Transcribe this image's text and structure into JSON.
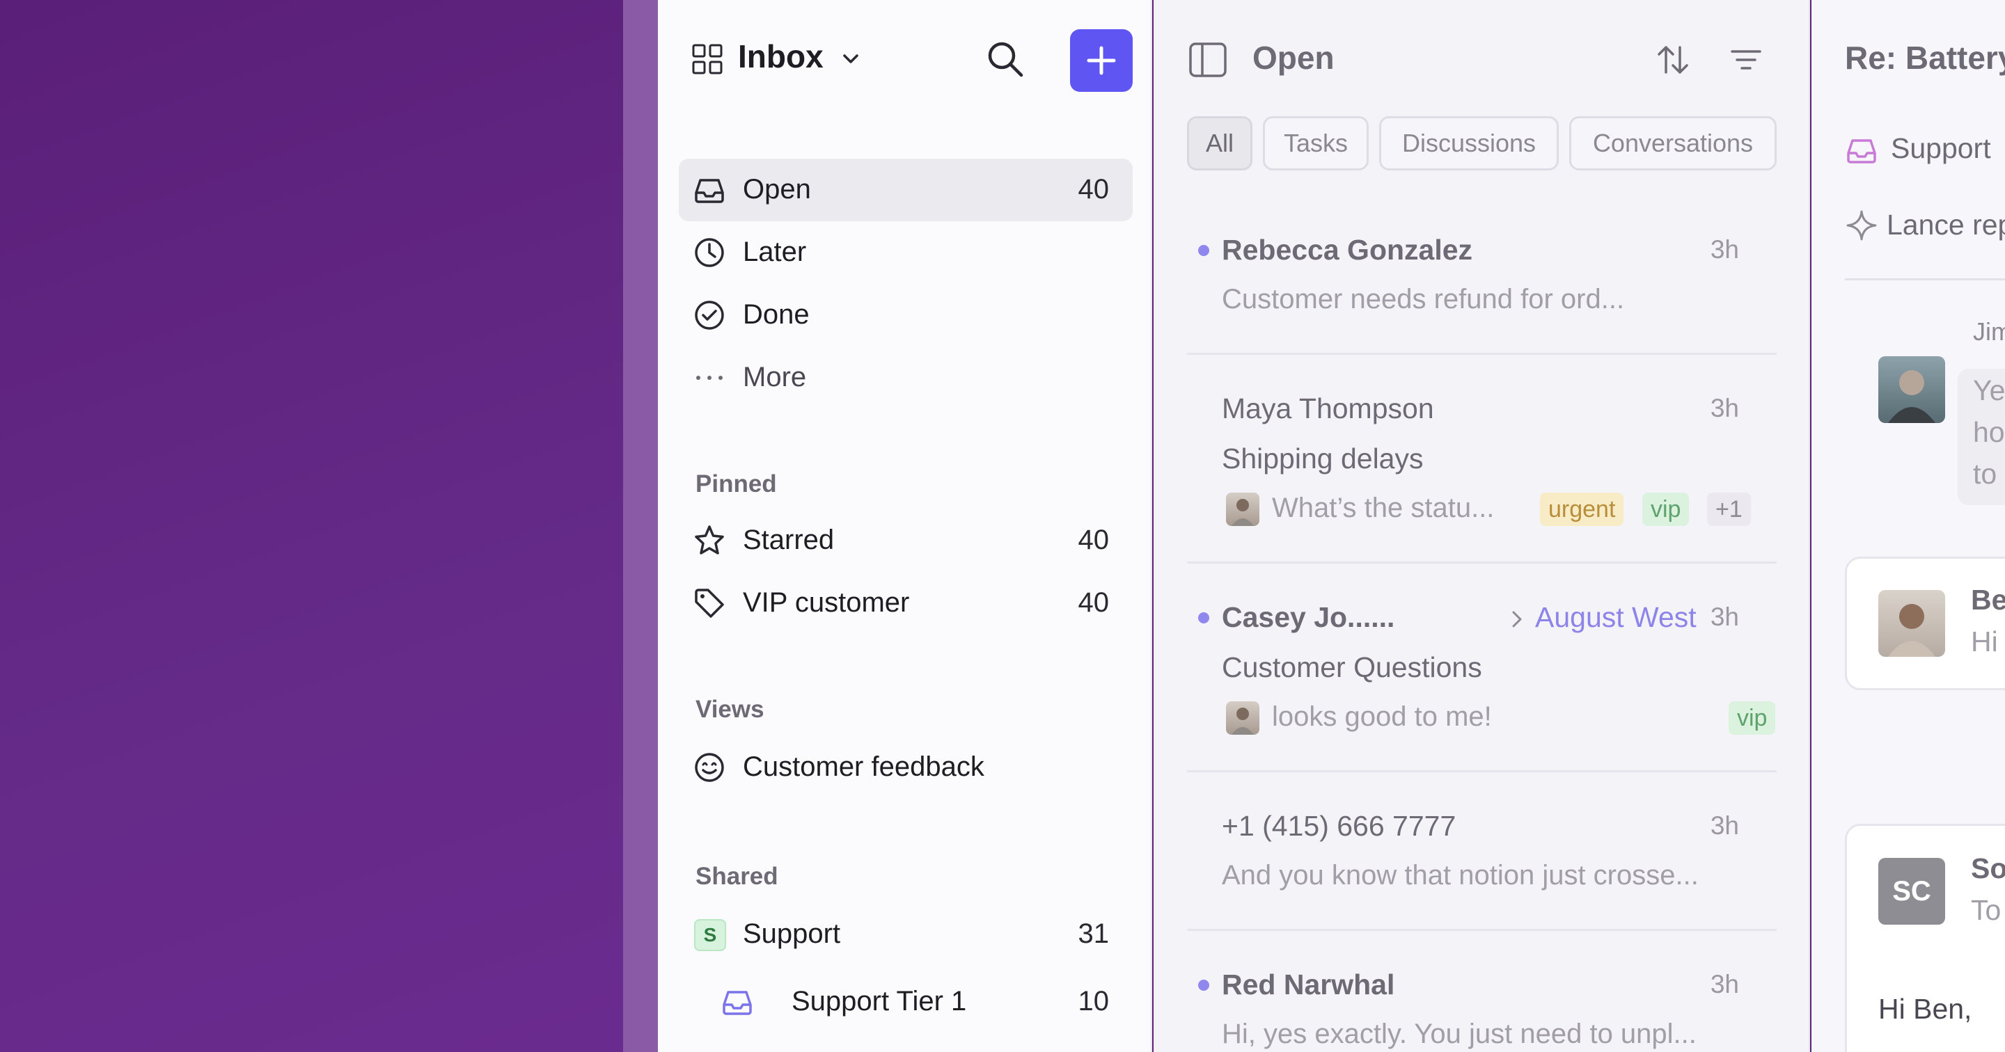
{
  "sidebar": {
    "title": "Inbox",
    "nav": [
      {
        "label": "Open",
        "count": "40"
      },
      {
        "label": "Later"
      },
      {
        "label": "Done"
      },
      {
        "label": "More"
      }
    ],
    "pinned_title": "Pinned",
    "pinned": [
      {
        "label": "Starred",
        "count": "40"
      },
      {
        "label": "VIP customer",
        "count": "40"
      }
    ],
    "views_title": "Views",
    "views": [
      {
        "label": "Customer feedback"
      }
    ],
    "shared_title": "Shared",
    "shared": [
      {
        "badge": "S",
        "label": "Support",
        "count": "31"
      },
      {
        "label": "Support Tier 1",
        "count": "10"
      }
    ]
  },
  "list": {
    "title": "Open",
    "filters": [
      "All",
      "Tasks",
      "Discussions",
      "Conversations"
    ],
    "conversations": [
      {
        "name": "Rebecca Gonzalez",
        "time": "3h",
        "preview": "Customer needs refund for ord..."
      },
      {
        "name": "Maya Thompson",
        "time": "3h",
        "subject": "Shipping delays",
        "preview": "What’s the statu...",
        "tags": [
          "urgent",
          "vip",
          "+1"
        ]
      },
      {
        "name": "Casey Jo......",
        "assignee": "August West",
        "time": "3h",
        "subject": "Customer Questions",
        "preview": "looks good to me!",
        "tags": [
          "vip"
        ]
      },
      {
        "name": "+1 (415) 666 7777",
        "time": "3h",
        "preview": "And you know that notion just crosse..."
      },
      {
        "name": "Red Narwhal",
        "time": "3h",
        "preview": "Hi, yes exactly. You just need to unpl..."
      }
    ]
  },
  "detail": {
    "title": "Re: Battery",
    "team": "Support",
    "ai_line": "Lance rep",
    "message_author": "Jim",
    "message_lines": [
      "Ye",
      "ho",
      "to"
    ],
    "card_author": "Be",
    "card_preview": "Hi",
    "email_avatar": "SC",
    "email_author": "So",
    "email_to": "To",
    "email_body": "Hi Ben,"
  },
  "colors": {
    "accent": "#5f55f2",
    "unread_dot": "#8f87ee",
    "background_purple": "#5d2278"
  }
}
